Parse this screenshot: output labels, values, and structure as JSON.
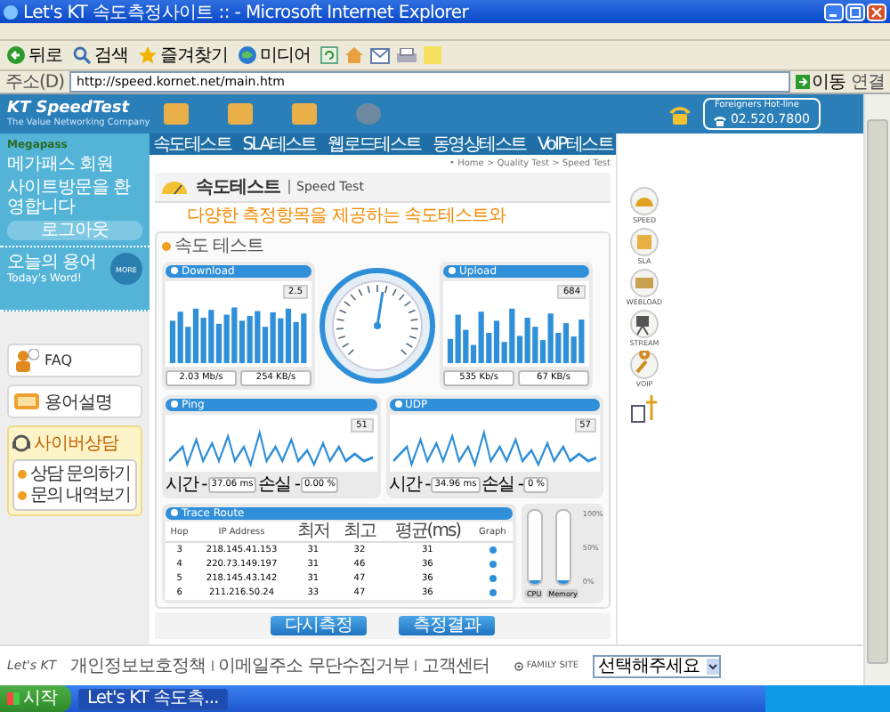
{
  "window": {
    "title": "Let's KT 속도측정사이트 :: - Microsoft Internet Explorer"
  },
  "toolbar": [
    {
      "label": "뒤로",
      "kind": "back"
    },
    {
      "label": "검색",
      "kind": "search"
    },
    {
      "label": "즐겨찾기",
      "kind": "favorites"
    },
    {
      "label": "미디어",
      "kind": "media"
    }
  ],
  "address_bar": {
    "label": "주소(D)",
    "value": "http://speed.kornet.net/main.htm",
    "go": "이동",
    "links": "연결"
  },
  "header": {
    "logo": "KT SpeedTest",
    "tagline": "The Value Networking Company",
    "hotline_label": "Foreigners Hot-line",
    "hotline_number": "02.520.7800"
  },
  "nav": [
    "속도테스트",
    "SLA테스트",
    "웹로드테스트",
    "동영상테스트",
    "VoIP테스트"
  ],
  "sidebar": {
    "member_logo": "Megapass",
    "member_label": "메가패스 회원",
    "welcome": "사이트방문을 환영합니다",
    "logout": "로그아웃",
    "word_title": "오늘의 용어",
    "word_subtitle": "Today's Word!",
    "more": "MORE",
    "links": [
      {
        "title": "FAQ",
        "kind": "faq"
      },
      {
        "title": "용어설명",
        "kind": "glossary"
      }
    ],
    "counsel_title": "사이버상담",
    "counsel_items": [
      "상담 문의하기",
      "문의 내역보기"
    ]
  },
  "breadcrumb": "• Home > Quality Test > Speed Test",
  "page_title": {
    "ko": "속도테스트",
    "en": "Speed Test"
  },
  "headline": "다양한 측정항목을 제공하는 속도테스트와",
  "panel": {
    "title": "속도 테스트",
    "download": {
      "label": "Download",
      "scale": "2.5",
      "readings": [
        "2.03 Mb/s",
        "254 KB/s"
      ]
    },
    "upload": {
      "label": "Upload",
      "scale": "684",
      "readings": [
        "535 Kb/s",
        "67 KB/s"
      ]
    },
    "lines": [
      {
        "label": "Ping",
        "scale": "51",
        "time_label": "시간 -",
        "time": "37.06 ms",
        "loss_label": "손실 -",
        "loss": "0.00 %"
      },
      {
        "label": "UDP",
        "scale": "57",
        "time_label": "시간 -",
        "time": "34.96 ms",
        "loss_label": "손실 -",
        "loss": "0 %"
      }
    ],
    "trace": {
      "title": "Trace Route",
      "columns": [
        "Hop",
        "IP Address",
        "최저",
        "최고",
        "평균(ms)",
        "Graph"
      ],
      "rows": [
        [
          "3",
          "218.145.41.153",
          "31",
          "32",
          "31"
        ],
        [
          "4",
          "220.73.149.197",
          "31",
          "46",
          "36"
        ],
        [
          "5",
          "218.145.43.142",
          "31",
          "47",
          "36"
        ],
        [
          "6",
          "211.216.50.24",
          "33",
          "47",
          "36"
        ]
      ]
    },
    "meters": [
      {
        "label": "CPU",
        "level": 0.05
      },
      {
        "label": "Memory",
        "level": 0.05
      }
    ],
    "meter_scale": [
      "100%",
      "50%",
      "0%"
    ]
  },
  "buttons": [
    "다시측정",
    "측정결과"
  ],
  "side_icons": [
    {
      "label": "SPEED",
      "kind": "speed"
    },
    {
      "label": "SLA",
      "kind": "sla"
    },
    {
      "label": "WEBLOAD",
      "kind": "webload"
    },
    {
      "label": "STREAM",
      "kind": "stream"
    },
    {
      "label": "VOIP",
      "kind": "voip"
    }
  ],
  "footer": {
    "logo": "Let's KT",
    "links": [
      "개인정보보호정책",
      "이메일주소 무단수집거부",
      "고객센터"
    ],
    "family_label": "FAMILY SITE",
    "family_select": "선택해주세요"
  },
  "taskbar": {
    "start": "시작",
    "tasks": [
      {
        "label": "Let's KT 속도측...",
        "selected": true
      }
    ]
  }
}
